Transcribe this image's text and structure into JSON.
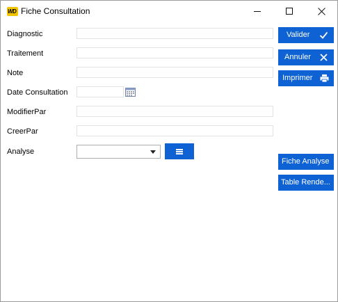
{
  "window": {
    "logo_text": "WD",
    "title": "Fiche Consultation",
    "controls": [
      "minimize-icon",
      "maximize-icon",
      "close-icon"
    ]
  },
  "form": {
    "diagnostic": {
      "label": "Diagnostic",
      "value": ""
    },
    "traitement": {
      "label": "Traitement",
      "value": ""
    },
    "note": {
      "label": "Note",
      "value": ""
    },
    "date_consultation": {
      "label": "Date Consultation",
      "value": "",
      "icon": "calendar-icon"
    },
    "modifier_par": {
      "label": "ModifierPar",
      "value": ""
    },
    "creer_par": {
      "label": "CreerPar",
      "value": ""
    },
    "analyse": {
      "label": "Analyse",
      "selected": "",
      "menu_icon": "list-icon"
    }
  },
  "actions": {
    "valider": {
      "label": "Valider",
      "icon": "check-icon"
    },
    "annuler": {
      "label": "Annuler",
      "icon": "close-icon"
    },
    "imprimer": {
      "label": "Imprimer",
      "icon": "printer-icon"
    },
    "fiche_analyse": {
      "label": "Fiche Analyse"
    },
    "table_rende": {
      "label": "Table Rende..."
    }
  },
  "colors": {
    "accent": "#0e62d4",
    "logo": "#f3c400",
    "field_border": "#e3e3e3"
  }
}
